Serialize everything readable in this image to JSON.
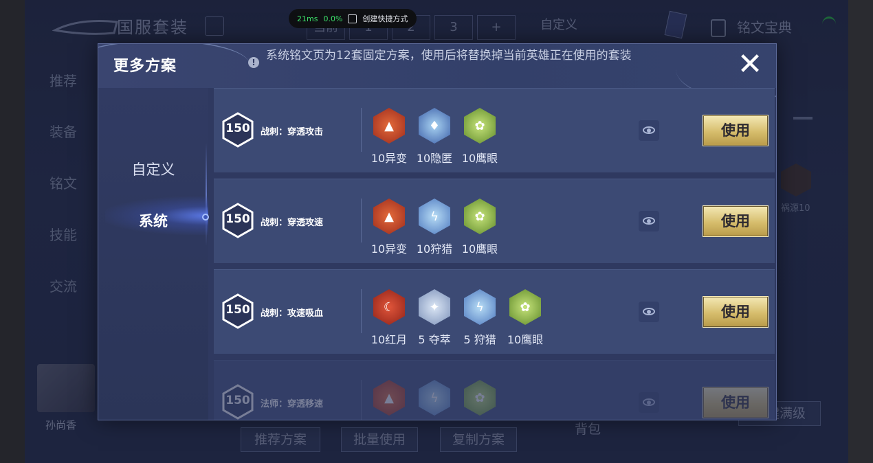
{
  "overlay": {
    "latency": "21ms",
    "loss": "0.0%",
    "shortcut_label": "创建快捷方式"
  },
  "background": {
    "title": "国服套装",
    "page_tabs": [
      "当前",
      "1",
      "2",
      "3",
      "+"
    ],
    "custom_label": "自定义",
    "guide_label": "铭文宝典",
    "side_menu": [
      "推荐",
      "装备",
      "铭文",
      "技能",
      "交流"
    ],
    "right_gem_label": "祸源10",
    "hero_name": "孙尚香",
    "buttons": [
      "推荐方案",
      "批量使用",
      "复制方案"
    ],
    "pack_label": "背包",
    "upgrade_label": "一键满级"
  },
  "dialog": {
    "title": "更多方案",
    "info": "系统铭文页为12套固定方案，使用后将替换掉当前英雄正在使用的套装",
    "close_symbol": "✕",
    "sidebar": [
      {
        "label": "自定义",
        "active": false
      },
      {
        "label": "系统",
        "active": true
      }
    ],
    "presets": [
      {
        "level": "150",
        "name": "战刺：穿透攻击",
        "use_label": "使用",
        "runes": [
          {
            "label": "10异变",
            "color": "#c2432a",
            "icon": "rune-red-icon"
          },
          {
            "label": "10隐匿",
            "color": "#4a70b8",
            "icon": "rune-blue-icon"
          },
          {
            "label": "10鹰眼",
            "color": "#7ea53a",
            "icon": "rune-green-icon"
          }
        ]
      },
      {
        "level": "150",
        "name": "战刺：穿透攻速",
        "use_label": "使用",
        "runes": [
          {
            "label": "10异变",
            "color": "#c2432a",
            "icon": "rune-red-icon"
          },
          {
            "label": "10狩猎",
            "color": "#5f87c6",
            "icon": "rune-blue-icon"
          },
          {
            "label": "10鹰眼",
            "color": "#7ea53a",
            "icon": "rune-green-icon"
          }
        ]
      },
      {
        "level": "150",
        "name": "战刺：攻速吸血",
        "use_label": "使用",
        "runes": [
          {
            "label": "10红月",
            "color": "#b8372a",
            "icon": "rune-red-icon"
          },
          {
            "label": "5 夺萃",
            "color": "#8fa3c8",
            "icon": "rune-blue-icon"
          },
          {
            "label": "5 狩猎",
            "color": "#5f87c6",
            "icon": "rune-blue-icon"
          },
          {
            "label": "10鹰眼",
            "color": "#7ea53a",
            "icon": "rune-green-icon"
          }
        ]
      },
      {
        "level": "150",
        "name": "法师：穿透移速",
        "use_label": "使用",
        "runes": [
          {
            "label": "",
            "color": "#c2432a",
            "icon": "rune-red-icon"
          },
          {
            "label": "",
            "color": "#5f87c6",
            "icon": "rune-blue-icon"
          },
          {
            "label": "",
            "color": "#7ea53a",
            "icon": "rune-green-icon"
          }
        ]
      }
    ]
  }
}
